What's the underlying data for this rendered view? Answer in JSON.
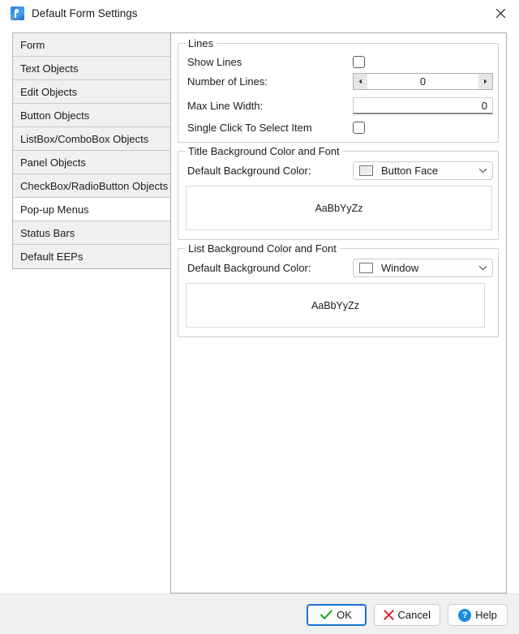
{
  "window": {
    "title": "Default Form Settings",
    "icon": "app-icon",
    "close_icon": "close-icon",
    "accent_color": "#1774cf"
  },
  "sidebar": {
    "items": [
      {
        "label": "Form",
        "selected": false
      },
      {
        "label": "Text Objects",
        "selected": false
      },
      {
        "label": "Edit Objects",
        "selected": false
      },
      {
        "label": "Button Objects",
        "selected": false
      },
      {
        "label": "ListBox/ComboBox Objects",
        "selected": false
      },
      {
        "label": "Panel Objects",
        "selected": false
      },
      {
        "label": "CheckBox/RadioButton Objects",
        "selected": false
      },
      {
        "label": "Pop-up Menus",
        "selected": true
      },
      {
        "label": "Status Bars",
        "selected": false
      },
      {
        "label": "Default EEPs",
        "selected": false
      }
    ]
  },
  "groups": {
    "lines": {
      "title": "Lines",
      "show_lines": {
        "label": "Show Lines",
        "checked": false
      },
      "number_of_lines": {
        "label": "Number of Lines:",
        "value": "0",
        "dec_icon": "arrow-left-icon",
        "inc_icon": "arrow-right-icon"
      },
      "max_line_width": {
        "label": "Max Line Width:",
        "value": "0"
      },
      "single_click": {
        "label": "Single Click To Select Item",
        "checked": false
      }
    },
    "title_bg": {
      "title": "Title Background Color and Font",
      "color_label": "Default Background Color:",
      "color_value": "Button Face",
      "color_swatch": "#ededed",
      "chevron_icon": "chevron-down-icon",
      "preview_text": "AaBbYyZz"
    },
    "list_bg": {
      "title": "List Background Color and Font",
      "color_label": "Default Background Color:",
      "color_value": "Window",
      "color_swatch": "#ffffff",
      "chevron_icon": "chevron-down-icon",
      "preview_text": "AaBbYyZz"
    }
  },
  "footer": {
    "ok": {
      "label": "OK",
      "icon": "check-icon"
    },
    "cancel": {
      "label": "Cancel",
      "icon": "x-icon"
    },
    "help": {
      "label": "Help",
      "icon": "question-icon",
      "glyph": "?"
    }
  }
}
